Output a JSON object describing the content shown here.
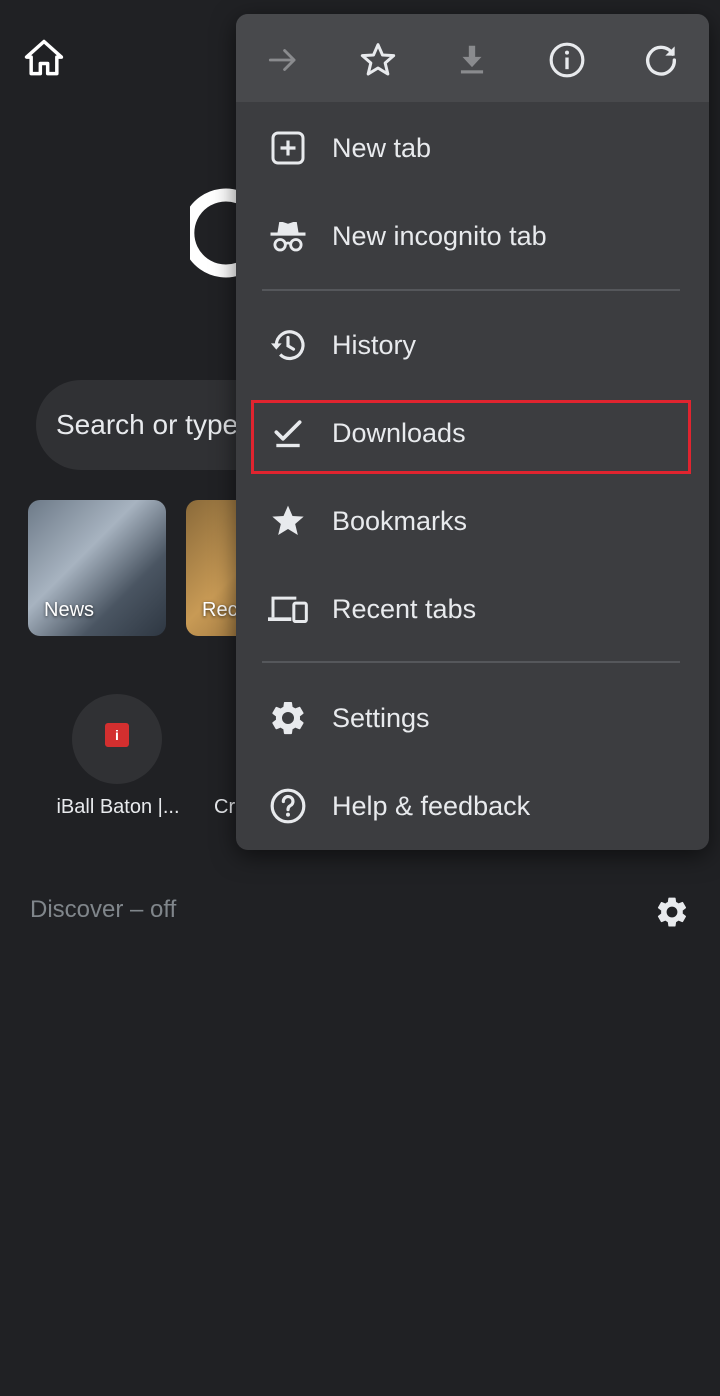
{
  "page": {
    "search_placeholder": "Search or type",
    "tiles": [
      {
        "label": "News"
      },
      {
        "label": "Rec"
      }
    ],
    "shortcuts": [
      {
        "label": "iBall Baton |...",
        "favicon_letter": "i"
      },
      {
        "label": "Cr"
      }
    ],
    "discover_label": "Discover – off",
    "icons": {
      "home": "home-icon",
      "discover_settings": "gear-icon"
    }
  },
  "menu": {
    "toolbar": [
      {
        "name": "forward",
        "icon": "arrow-forward-icon"
      },
      {
        "name": "bookmark",
        "icon": "star-outline-icon"
      },
      {
        "name": "download_page",
        "icon": "download-icon"
      },
      {
        "name": "page_info",
        "icon": "info-icon"
      },
      {
        "name": "reload",
        "icon": "refresh-icon"
      }
    ],
    "items": [
      {
        "label": "New tab",
        "icon": "plus-box-icon"
      },
      {
        "label": "New incognito tab",
        "icon": "incognito-icon"
      },
      {
        "label": "History",
        "icon": "history-icon"
      },
      {
        "label": "Downloads",
        "icon": "download-done-icon",
        "highlighted": true
      },
      {
        "label": "Bookmarks",
        "icon": "star-icon"
      },
      {
        "label": "Recent tabs",
        "icon": "devices-icon"
      },
      {
        "label": "Settings",
        "icon": "gear-icon"
      },
      {
        "label": "Help & feedback",
        "icon": "help-icon"
      }
    ]
  },
  "colors": {
    "background": "#202124",
    "menu": "#3c3d40",
    "toolbar": "#48494c",
    "highlight_border": "#e0242f",
    "text": "#e8eaed"
  }
}
